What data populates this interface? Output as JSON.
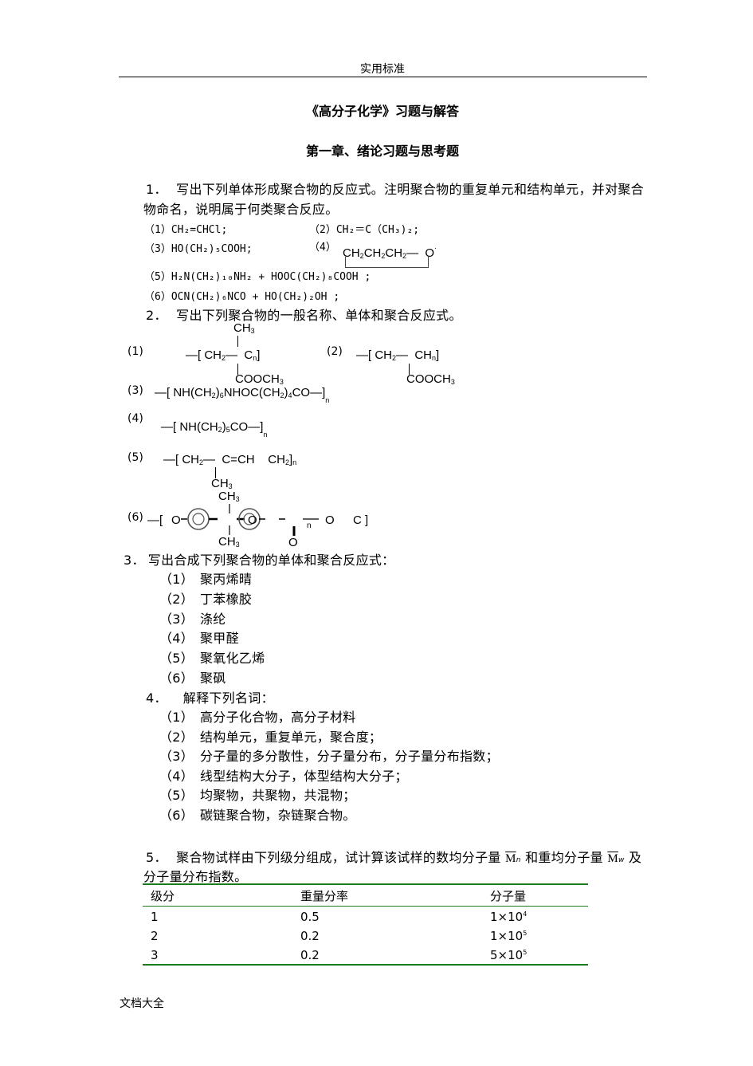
{
  "header": {
    "text": "实用标准"
  },
  "doc_title": "《高分子化学》习题与解答",
  "chapter_title": "第一章、绪论习题与思考题",
  "q1": {
    "num": "1．",
    "text_line1": "写出下列单体形成聚合物的反应式。注明聚合物的重复单元和结构单元，并对聚合",
    "text_line2": "物命名，说明属于何类聚合反应。",
    "items": [
      {
        "label": "（1）",
        "formula": "CH₂=CHCl;"
      },
      {
        "label": "（2）",
        "formula": "CH₂＝C（CH₃)₂;"
      },
      {
        "label": "（3）",
        "formula": "HO(CH₂)₅COOH;"
      },
      {
        "label": "（4）",
        "formula": "CH₂CH₂CH₂— O"
      },
      {
        "label": "（5）",
        "formula": "H₂N(CH₂)₁₀NH₂ + HOOC(CH₂)₈COOH ;"
      },
      {
        "label": "（6）",
        "formula": "OCN(CH₂)₆NCO + HO(CH₂)₂OH ;"
      }
    ]
  },
  "q2": {
    "num": "2．",
    "text": "写出下列聚合物的一般名称、单体和聚合反应式。",
    "items": [
      {
        "label": "(1)",
        "main": "[CH₂— C]n",
        "top": "CH₃",
        "bottom": "COOCH₃"
      },
      {
        "label": "(2)",
        "main": "[CH₂— CH]n",
        "bottom": "COOCH₃"
      },
      {
        "label": "(3)",
        "main": "[NH(CH₂)₆NHOC(CH₂)₄CO]n"
      },
      {
        "label": "(4)",
        "main": "[NH(CH₂)₅CO]n"
      },
      {
        "label": "(5)",
        "main": "[CH₂— C=CH   CH₂]n",
        "bottom": "CH₃"
      },
      {
        "label": "(6)",
        "main": "[O—C₆H₄—C(CH₃)₂—C₆H₄—O—C(=O)]n",
        "top": "CH₃",
        "bottom": "CH₃",
        "carbonyl": "O"
      }
    ]
  },
  "q3": {
    "num": "3．",
    "text": "写出合成下列聚合物的单体和聚合反应式：",
    "items": [
      {
        "label": "（1）",
        "text": "聚丙烯晴"
      },
      {
        "label": "（2）",
        "text": "丁苯橡胶"
      },
      {
        "label": "（3）",
        "text": "涤纶"
      },
      {
        "label": "（4）",
        "text": "聚甲醛"
      },
      {
        "label": "（5）",
        "text": "聚氧化乙烯"
      },
      {
        "label": "（6）",
        "text": "聚砜"
      }
    ]
  },
  "q4": {
    "num": "4．",
    "text": "解释下列名词：",
    "items": [
      {
        "label": "（1）",
        "text": "高分子化合物，高分子材料"
      },
      {
        "label": "（2）",
        "text": "结构单元，重复单元，聚合度；"
      },
      {
        "label": "（3）",
        "text": "分子量的多分散性，分子量分布，分子量分布指数；"
      },
      {
        "label": "（4）",
        "text": "线型结构大分子，体型结构大分子；"
      },
      {
        "label": "（5）",
        "text": "均聚物，共聚物，共混物；"
      },
      {
        "label": "（6）",
        "text": "碳链聚合物，杂链聚合物。"
      }
    ]
  },
  "q5": {
    "num": "5．",
    "text_a": "聚合物试样由下列级分组成，试计算该试样的数均分子量",
    "mn": "M",
    "mn_sub": "n",
    "text_b": "和重均分子量",
    "mw": "M",
    "mw_sub": "w",
    "text_c": "及",
    "text_line2": "分子量分布指数。",
    "table": {
      "headers": [
        "级分",
        "重量分率",
        "分子量"
      ],
      "rows": [
        {
          "fraction": "1",
          "weight_fraction": "0.5",
          "mw_base": "1×10",
          "mw_exp": "4"
        },
        {
          "fraction": "2",
          "weight_fraction": "0.2",
          "mw_base": "1×10",
          "mw_exp": "5"
        },
        {
          "fraction": "3",
          "weight_fraction": "0.2",
          "mw_base": "5×10",
          "mw_exp": "5"
        }
      ]
    }
  },
  "footer": {
    "text": "文档大全"
  },
  "colors": {
    "table_rule": "#1c7a1c",
    "text": "#000000"
  }
}
